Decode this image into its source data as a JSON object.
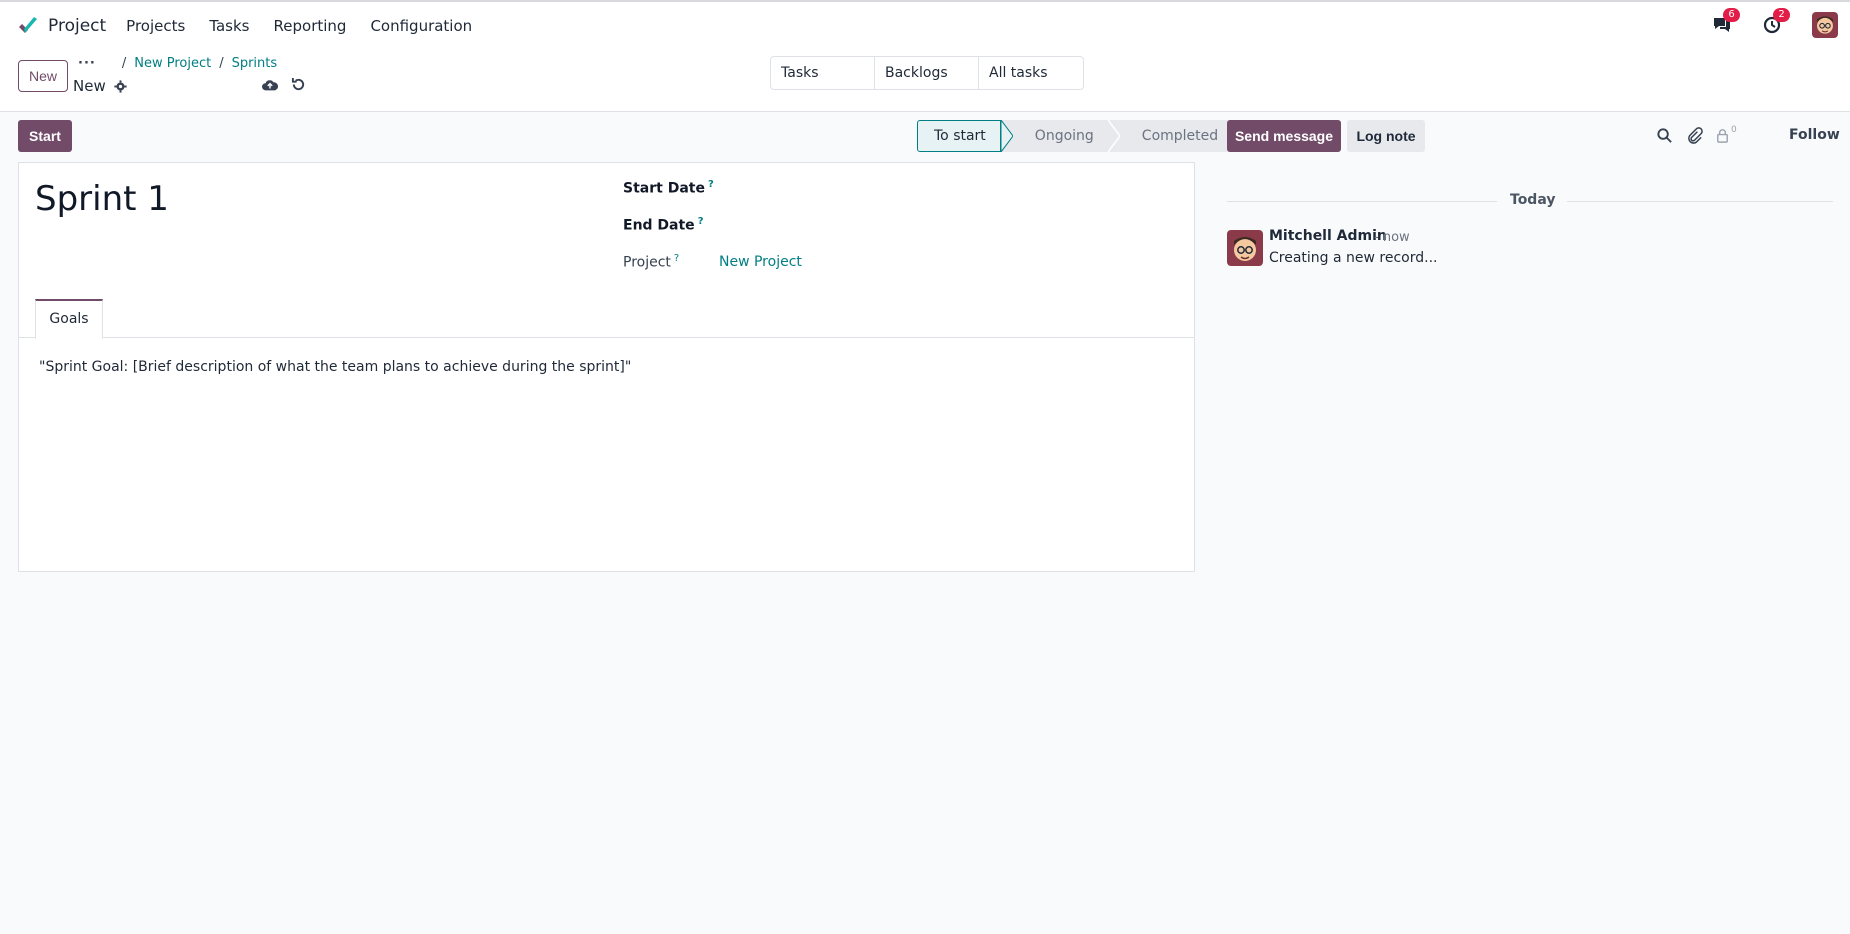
{
  "navbar": {
    "app_name": "Project",
    "menu": [
      "Projects",
      "Tasks",
      "Reporting",
      "Configuration"
    ],
    "messages_count": "6",
    "activities_count": "2"
  },
  "control": {
    "new_label": "New",
    "breadcrumb": [
      "New Project",
      "Sprints"
    ],
    "record_name": "New",
    "smart_buttons": [
      "Tasks",
      "Backlogs",
      "All tasks"
    ]
  },
  "status": {
    "start_label": "Start",
    "stages": [
      "To start",
      "Ongoing",
      "Completed"
    ],
    "active_stage": "To start"
  },
  "form": {
    "title": "Sprint 1",
    "start_date_label": "Start Date",
    "end_date_label": "End Date",
    "project_label": "Project",
    "project_value": "New Project",
    "tab_goals": "Goals",
    "goal_text": "\"Sprint Goal: [Brief description of what the team plans to achieve during the sprint]\""
  },
  "chatter": {
    "send_message_label": "Send message",
    "log_note_label": "Log note",
    "followers_count": "0",
    "follow_label": "Follow",
    "date_separator": "Today",
    "message": {
      "author": "Mitchell Admin",
      "time": "- now",
      "body": "Creating a new record..."
    }
  },
  "colors": {
    "brand": "#714b67",
    "link": "#017e84"
  }
}
